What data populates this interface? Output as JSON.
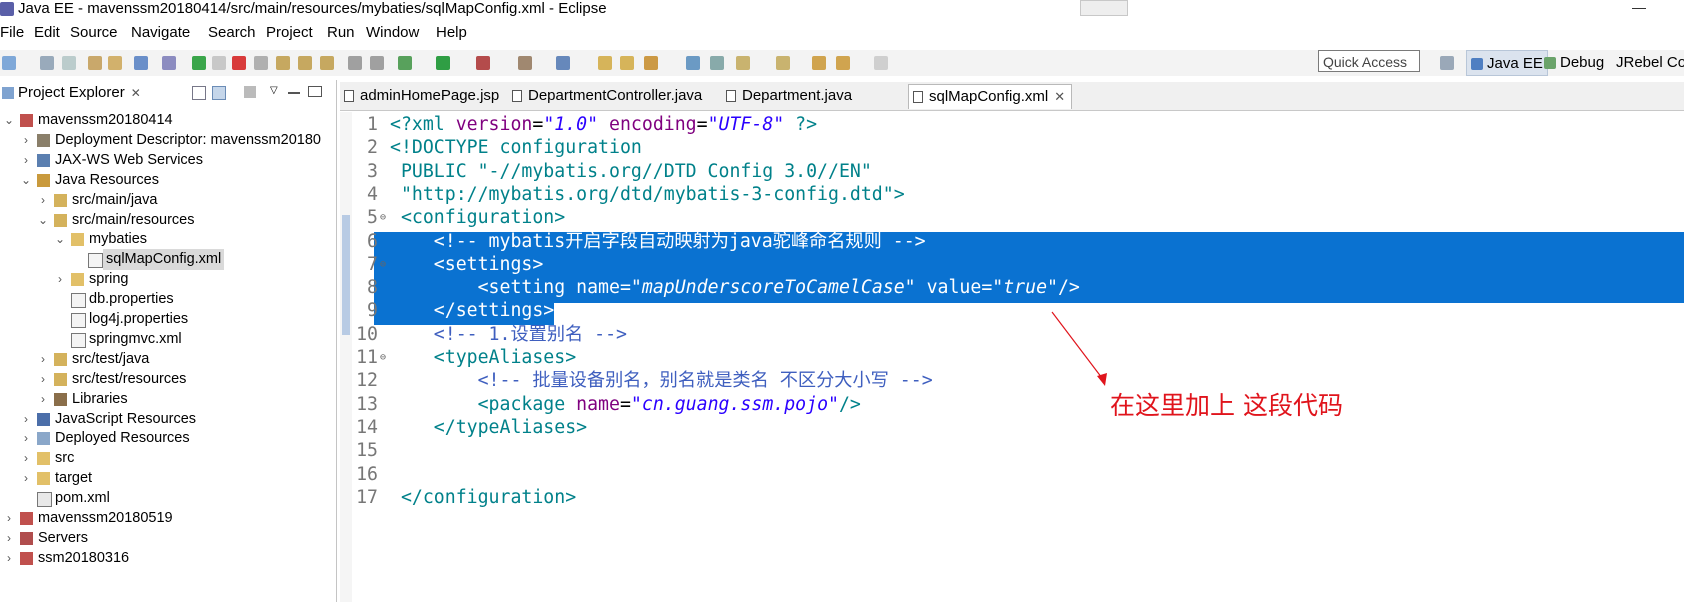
{
  "window": {
    "title": "Java EE - mavenssm20180414/src/main/resources/mybaties/sqlMapConfig.xml - Eclipse"
  },
  "menu": [
    "File",
    "Edit",
    "Source",
    "Navigate",
    "Search",
    "Project",
    "Run",
    "Window",
    "Help"
  ],
  "toolbar": {
    "quick_access": "Quick Access",
    "perspectives": [
      "Java EE",
      "Debug",
      "JRebel Co"
    ]
  },
  "project_explorer": {
    "title": "Project Explorer",
    "tree": [
      {
        "label": "mavenssm20180414",
        "depth": 0,
        "expanded": true,
        "icon": "project-icon"
      },
      {
        "label": "Deployment Descriptor: mavenssm20180",
        "depth": 1,
        "expanded": false,
        "icon": "descriptor-icon"
      },
      {
        "label": "JAX-WS Web Services",
        "depth": 1,
        "expanded": false,
        "icon": "webservice-icon"
      },
      {
        "label": "Java Resources",
        "depth": 1,
        "expanded": true,
        "icon": "java-resources-icon"
      },
      {
        "label": "src/main/java",
        "depth": 2,
        "expanded": false,
        "icon": "source-folder-icon"
      },
      {
        "label": "src/main/resources",
        "depth": 2,
        "expanded": true,
        "icon": "source-folder-icon"
      },
      {
        "label": "mybaties",
        "depth": 3,
        "expanded": true,
        "icon": "folder-icon"
      },
      {
        "label": "sqlMapConfig.xml",
        "depth": 4,
        "expanded": null,
        "icon": "xml-file-icon",
        "selected": true
      },
      {
        "label": "spring",
        "depth": 3,
        "expanded": false,
        "icon": "folder-icon"
      },
      {
        "label": "db.properties",
        "depth": 3,
        "expanded": null,
        "icon": "file-icon"
      },
      {
        "label": "log4j.properties",
        "depth": 3,
        "expanded": null,
        "icon": "file-icon"
      },
      {
        "label": "springmvc.xml",
        "depth": 3,
        "expanded": null,
        "icon": "xml-file-icon"
      },
      {
        "label": "src/test/java",
        "depth": 2,
        "expanded": false,
        "icon": "source-folder-icon"
      },
      {
        "label": "src/test/resources",
        "depth": 2,
        "expanded": false,
        "icon": "source-folder-icon"
      },
      {
        "label": "Libraries",
        "depth": 2,
        "expanded": false,
        "icon": "library-icon"
      },
      {
        "label": "JavaScript Resources",
        "depth": 1,
        "expanded": false,
        "icon": "js-resources-icon"
      },
      {
        "label": "Deployed Resources",
        "depth": 1,
        "expanded": false,
        "icon": "deployed-icon"
      },
      {
        "label": "src",
        "depth": 1,
        "expanded": false,
        "icon": "folder-icon"
      },
      {
        "label": "target",
        "depth": 1,
        "expanded": false,
        "icon": "folder-icon"
      },
      {
        "label": "pom.xml",
        "depth": 1,
        "expanded": null,
        "icon": "maven-file-icon"
      },
      {
        "label": "mavenssm20180519",
        "depth": 0,
        "expanded": false,
        "icon": "project-icon"
      },
      {
        "label": "Servers",
        "depth": 0,
        "expanded": false,
        "icon": "servers-icon"
      },
      {
        "label": "ssm20180316",
        "depth": 0,
        "expanded": false,
        "icon": "project-icon"
      }
    ]
  },
  "editor": {
    "tabs": [
      {
        "label": "adminHomePage.jsp",
        "active": false
      },
      {
        "label": "DepartmentController.java",
        "active": false
      },
      {
        "label": "Department.java",
        "active": false
      },
      {
        "label": "sqlMapConfig.xml",
        "active": true
      }
    ],
    "lines": [
      {
        "num": "1",
        "fold": "",
        "selected": false,
        "tokens": [
          [
            "tag",
            "<?xml "
          ],
          [
            "attr",
            "version"
          ],
          [
            "plain",
            "="
          ],
          [
            "str",
            "\"1.0\""
          ],
          [
            "plain",
            " "
          ],
          [
            "attr",
            "encoding"
          ],
          [
            "plain",
            "="
          ],
          [
            "str",
            "\"UTF-8\""
          ],
          [
            "tag",
            " ?>"
          ]
        ]
      },
      {
        "num": "2",
        "fold": "",
        "selected": false,
        "tokens": [
          [
            "tag",
            "<!DOCTYPE configuration"
          ]
        ]
      },
      {
        "num": "3",
        "fold": "",
        "selected": false,
        "tokens": [
          [
            "tag",
            " PUBLIC "
          ],
          [
            "tag",
            "\"-//mybatis.org//DTD Config 3.0//EN\""
          ]
        ]
      },
      {
        "num": "4",
        "fold": "",
        "selected": false,
        "tokens": [
          [
            "tag",
            " \"http://mybatis.org/dtd/mybatis-3-config.dtd\">"
          ]
        ]
      },
      {
        "num": "5",
        "fold": "⊖",
        "selected": false,
        "tokens": [
          [
            "tag",
            " <configuration>"
          ]
        ]
      },
      {
        "num": "6",
        "fold": "",
        "selected": true,
        "tokens": [
          [
            "cmt",
            "    <!-- mybatis开启字段自动映射为java驼峰命名规则 -->"
          ]
        ]
      },
      {
        "num": "7",
        "fold": "⊖",
        "selected": true,
        "tokens": [
          [
            "tag",
            "    <settings>"
          ]
        ]
      },
      {
        "num": "8",
        "fold": "",
        "selected": true,
        "tokens": [
          [
            "tag",
            "        <setting "
          ],
          [
            "attr",
            "name"
          ],
          [
            "plain",
            "="
          ],
          [
            "str",
            "\"mapUnderscoreToCamelCase\""
          ],
          [
            "plain",
            " "
          ],
          [
            "attr",
            "value"
          ],
          [
            "plain",
            "="
          ],
          [
            "str",
            "\"true\""
          ],
          [
            "tag",
            "/>"
          ]
        ]
      },
      {
        "num": "9",
        "fold": "",
        "selected": true,
        "tokens": [
          [
            "tag",
            "    </settings>"
          ]
        ]
      },
      {
        "num": "10",
        "fold": "",
        "selected": false,
        "tokens": [
          [
            "cmt",
            "    <!-- 1.设置别名 -->"
          ]
        ]
      },
      {
        "num": "11",
        "fold": "⊖",
        "selected": false,
        "tokens": [
          [
            "tag",
            "    <typeAliases>"
          ]
        ]
      },
      {
        "num": "12",
        "fold": "",
        "selected": false,
        "tokens": [
          [
            "cmt",
            "        <!-- 批量设备别名，别名就是类名 不区分大小写 -->"
          ]
        ]
      },
      {
        "num": "13",
        "fold": "",
        "selected": false,
        "tokens": [
          [
            "tag",
            "        <package "
          ],
          [
            "attr",
            "name"
          ],
          [
            "plain",
            "="
          ],
          [
            "str",
            "\"cn.guang.ssm.pojo\""
          ],
          [
            "tag",
            "/>"
          ]
        ]
      },
      {
        "num": "14",
        "fold": "",
        "selected": false,
        "tokens": [
          [
            "tag",
            "    </typeAliases>"
          ]
        ]
      },
      {
        "num": "15",
        "fold": "",
        "selected": false,
        "tokens": []
      },
      {
        "num": "16",
        "fold": "",
        "selected": false,
        "tokens": []
      },
      {
        "num": "17",
        "fold": "",
        "selected": false,
        "tokens": [
          [
            "tag",
            " </configuration>"
          ]
        ]
      }
    ]
  },
  "annotation": {
    "text": "在这里加上 这段代码",
    "color": "#e0141c"
  },
  "colors": {
    "selection": "#0a72d1",
    "tag": "#00818a",
    "attr": "#7f007f",
    "string": "#2a00ff",
    "comment": "#3f5fbf"
  }
}
